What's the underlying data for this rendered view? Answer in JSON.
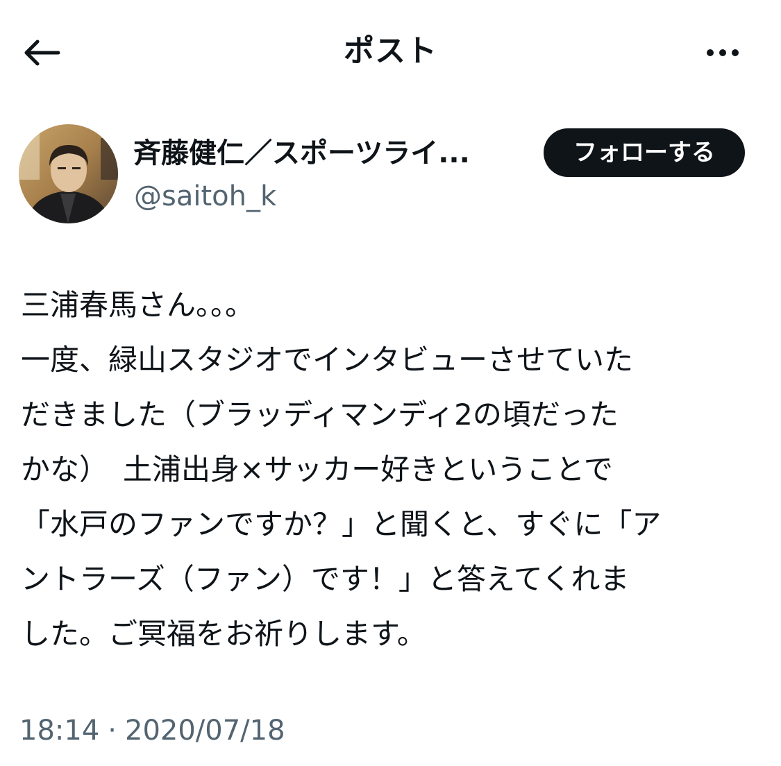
{
  "header": {
    "title": "ポスト",
    "back_icon": "arrow-left-icon",
    "more_icon": "more-horizontal-icon"
  },
  "author": {
    "display_name": "斉藤健仁／スポーツライ...",
    "handle": "@saitoh_k",
    "follow_label": "フォローする"
  },
  "post": {
    "lines": [
      "三浦春馬さん。。。",
      "一度、緑山スタジオでインタビューさせていた",
      "だきました（ブラッディマンディ2の頃だった",
      "かな）　土浦出身×サッカー好きということで",
      "「水戸のファンですか？」と聞くと、すぐに「ア",
      "ントラーズ（ファン）です！」と答えてくれま",
      "した。ご冥福をお祈りします。"
    ],
    "time": "18:14",
    "separator": "·",
    "date": "2020/07/18"
  },
  "colors": {
    "text": "#0f1419",
    "secondary": "#536471",
    "button_bg": "#0f1419",
    "button_text": "#ffffff"
  }
}
